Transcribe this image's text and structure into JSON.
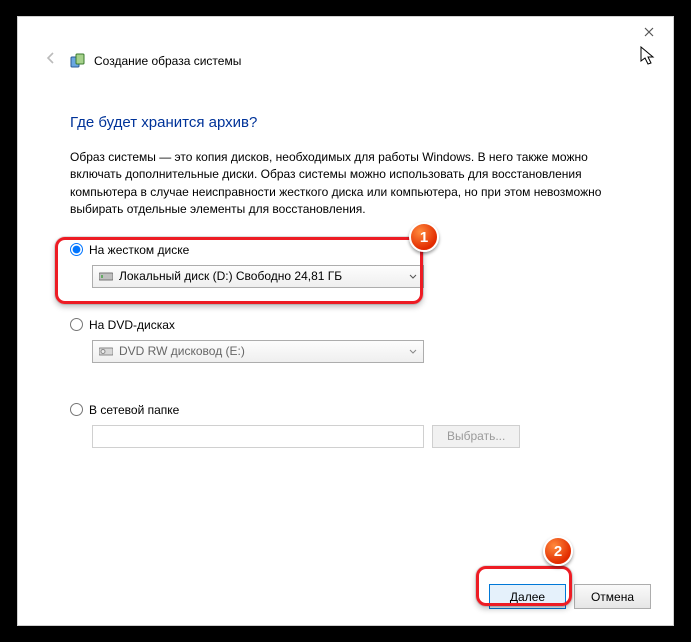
{
  "header": {
    "title": "Создание образа системы"
  },
  "page": {
    "heading": "Где будет хранится архив?",
    "description": "Образ системы — это копия дисков, необходимых для работы Windows. В него также можно включать дополнительные диски. Образ системы можно использовать для восстановления компьютера в случае неисправности жесткого диска или компьютера, но при этом невозможно выбирать отдельные элементы для восстановления."
  },
  "options": {
    "hdd": {
      "label": "На жестком диске",
      "value": "Локальный диск (D:)  Свободно 24,81 ГБ"
    },
    "dvd": {
      "label": "На DVD-дисках",
      "value": "DVD RW дисковод (E:)"
    },
    "network": {
      "label": "В сетевой папке",
      "browse": "Выбрать..."
    }
  },
  "footer": {
    "next": "Далее",
    "cancel": "Отмена"
  },
  "annotations": {
    "badge1": "1",
    "badge2": "2"
  }
}
